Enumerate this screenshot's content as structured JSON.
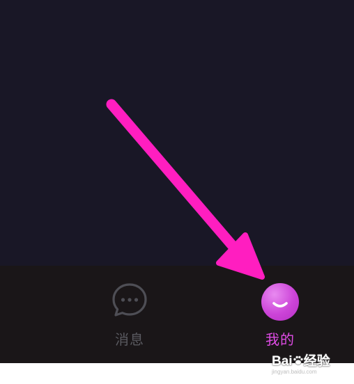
{
  "tabbar": {
    "tabs": [
      {
        "label": "消息",
        "icon": "chat-bubble-icon",
        "state": "inactive"
      },
      {
        "label": "我的",
        "icon": "avatar-smile-icon",
        "state": "active"
      }
    ]
  },
  "annotation": {
    "icon": "pointer-arrow-icon",
    "color": "#ff1ec0"
  },
  "watermark": {
    "logo_prefix": "Bai",
    "logo_suffix": "经验",
    "site": "jingyan.baidu.com"
  },
  "colors": {
    "screen_background": "#191726",
    "tabbar_background": "#1a1618",
    "active_tab": "#e04ce6",
    "inactive_tab": "#5a5a60"
  }
}
